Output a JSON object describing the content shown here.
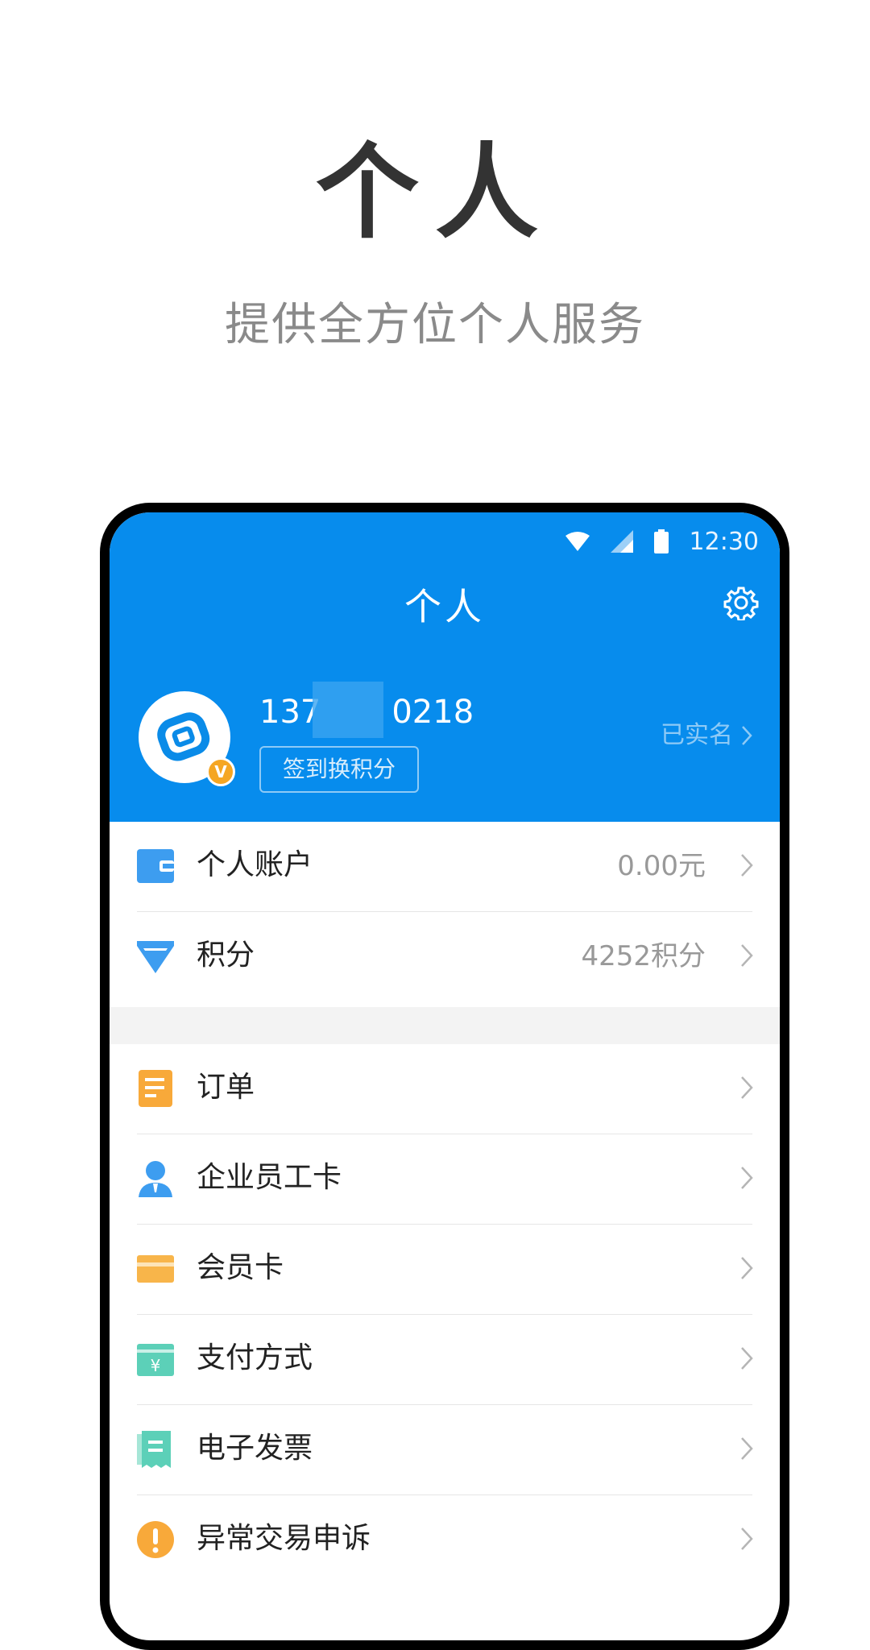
{
  "promo": {
    "title": "个人",
    "subtitle": "提供全方位个人服务"
  },
  "status_bar": {
    "time": "12:30",
    "icons": [
      "wifi-icon",
      "signal-icon",
      "battery-icon"
    ]
  },
  "app": {
    "title": "个人",
    "settings_icon": "gear-icon"
  },
  "profile": {
    "phone_prefix": "137",
    "phone_suffix": "0218",
    "checkin_label": "签到换积分",
    "verified_label": "已实名",
    "badge": "V"
  },
  "account_section": [
    {
      "label": "个人账户",
      "value": "0.00元",
      "icon": "wallet-icon",
      "color": "#3d9df0"
    },
    {
      "label": "积分",
      "value": "4252积分",
      "icon": "diamond-icon",
      "color": "#3d9df0"
    }
  ],
  "menu_section": [
    {
      "label": "订单",
      "icon": "order-icon",
      "color": "#f8a93a"
    },
    {
      "label": "企业员工卡",
      "icon": "employee-icon",
      "color": "#3d9df0"
    },
    {
      "label": "会员卡",
      "icon": "member-card-icon",
      "color": "#f8b54a"
    },
    {
      "label": "支付方式",
      "icon": "payment-icon",
      "color": "#5cd0b8"
    },
    {
      "label": "电子发票",
      "icon": "invoice-icon",
      "color": "#5cd0b8"
    },
    {
      "label": "异常交易申诉",
      "icon": "alert-icon",
      "color": "#f8a93a"
    }
  ],
  "colors": {
    "header_blue": "#078ced",
    "title_dark": "#333333",
    "subtitle_gray": "#8a8a8a"
  }
}
